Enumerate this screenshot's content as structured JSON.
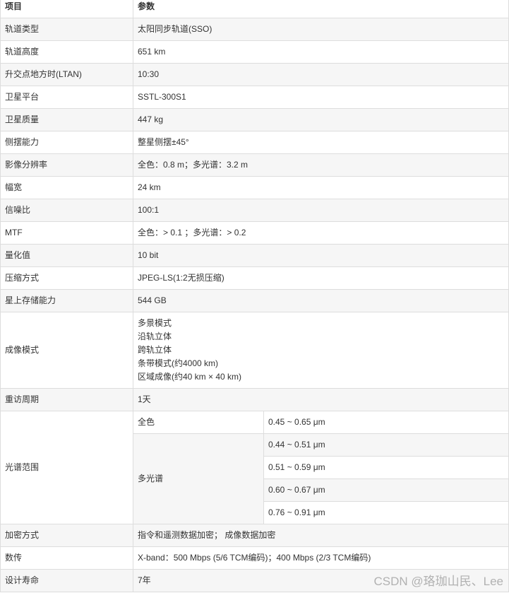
{
  "header": {
    "item": "项目",
    "param": "参数"
  },
  "rows": [
    {
      "label": "轨道类型",
      "value": "太阳同步轨道(SSO)"
    },
    {
      "label": "轨道高度",
      "value": "651 km"
    },
    {
      "label": "升交点地方时(LTAN)",
      "value": "10:30"
    },
    {
      "label": "卫星平台",
      "value": "SSTL-300S1"
    },
    {
      "label": "卫星质量",
      "value": "447 kg"
    },
    {
      "label": "侧摆能力",
      "value": "整星侧摆±45°"
    },
    {
      "label": "影像分辨率",
      "value": "全色：0.8 m；多光谱：3.2 m"
    },
    {
      "label": "幅宽",
      "value": "24 km"
    },
    {
      "label": "信噪比",
      "value": "100:1"
    },
    {
      "label": "MTF",
      "value": "全色：> 0.1 ；多光谱：> 0.2"
    },
    {
      "label": "量化值",
      "value": "10 bit"
    },
    {
      "label": "压缩方式",
      "value": "JPEG-LS(1:2无损压缩)"
    },
    {
      "label": "星上存储能力",
      "value": "544 GB"
    }
  ],
  "imaging": {
    "label": "成像模式",
    "modes": [
      "多景模式",
      "沿轨立体",
      "跨轨立体",
      "条带模式(约4000 km)",
      "区域成像(约40 km × 40 km)"
    ]
  },
  "revisit": {
    "label": "重访周期",
    "value": "1天"
  },
  "spectral": {
    "label": "光谱范围",
    "pan": {
      "label": "全色",
      "range": "0.45 ~ 0.65 μm"
    },
    "ms": {
      "label": "多光谱",
      "ranges": [
        "0.44 ~ 0.51 μm",
        "0.51 ~ 0.59 μm",
        "0.60 ~ 0.67 μm",
        "0.76 ~ 0.91 μm"
      ]
    }
  },
  "tail": [
    {
      "label": "加密方式",
      "value": "指令和遥测数据加密； 成像数据加密"
    },
    {
      "label": "数传",
      "value": "X-band：500 Mbps (5/6 TCM编码)；400 Mbps (2/3 TCM编码)"
    },
    {
      "label": "设计寿命",
      "value": "7年"
    }
  ],
  "watermark": "CSDN @珞珈山民、Lee"
}
